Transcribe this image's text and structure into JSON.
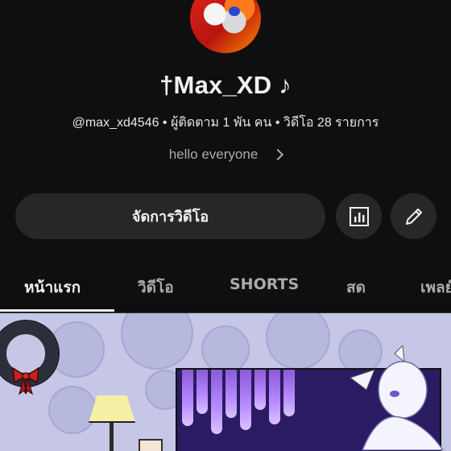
{
  "channel": {
    "name": "†Max_XD ♪",
    "meta": "@max_xd4546 • ผู้ติดตาม 1 พัน คน • วิดีโอ 28 รายการ",
    "description": "hello everyone"
  },
  "actions": {
    "manage_videos_label": "จัดการวิดีโอ",
    "stats_icon": "bar-chart-icon",
    "edit_icon": "pencil-icon"
  },
  "tabs": [
    {
      "label": "หน้าแรก",
      "active": true
    },
    {
      "label": "วิดีโอ",
      "active": false
    },
    {
      "label": "SHORTS",
      "active": false
    },
    {
      "label": "สด",
      "active": false
    },
    {
      "label": "เพลย์",
      "active": false
    }
  ],
  "colors": {
    "background": "#0f0f0f",
    "button_bg": "#272727",
    "text_primary": "#f1f1f1",
    "text_secondary": "#aaaaaa"
  }
}
